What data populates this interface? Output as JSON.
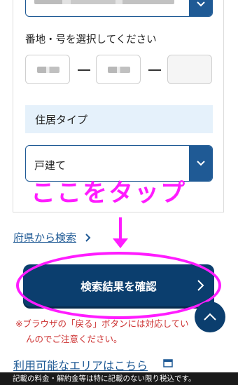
{
  "address": {
    "banchi_label": "番地・号を選択してください",
    "separator": "—"
  },
  "residence": {
    "section_title": "住居タイプ",
    "selected_value": "戸建て"
  },
  "annotation": {
    "tap_here": "ここをタップ"
  },
  "prefecture_search_link": "府県から検索",
  "confirm_button": {
    "label": "検索結果を確認"
  },
  "notice": {
    "line1": "※ブラウザの「戻る」ボタンには対応してい",
    "line2": "んのでご注意ください。"
  },
  "available_area_link": "利用可能なエリアはこちら",
  "footer_text": "記載の料金・解約金等は特に記載のない限り税込です。",
  "colors": {
    "brand_navy": "#0b3e6e",
    "select_blue": "#1f5a95",
    "annotation_magenta": "#ff1cff",
    "notice_red": "#cc2f2f",
    "section_bg": "#e5f1fb"
  }
}
